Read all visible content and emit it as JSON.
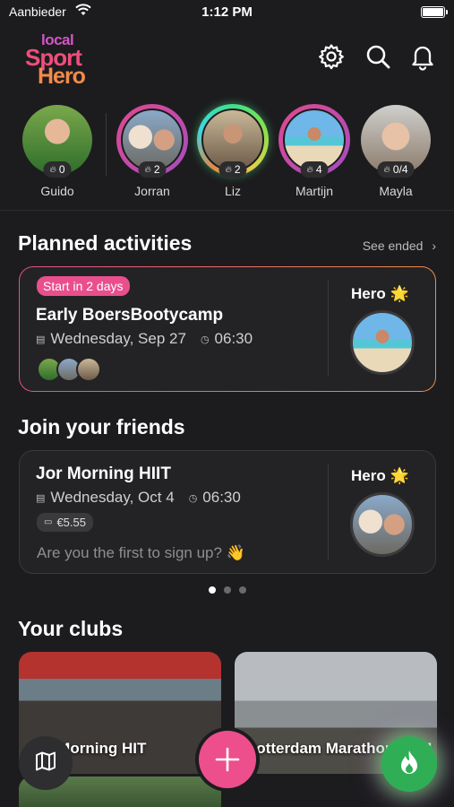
{
  "status_bar": {
    "carrier": "Aanbieder",
    "time": "1:12 PM"
  },
  "logo": {
    "line1": "local",
    "line2": "Sport",
    "line3": "Hero"
  },
  "header_icons": [
    "gear-icon",
    "search-icon",
    "bell-icon"
  ],
  "stories": [
    {
      "name": "Guido",
      "count": "0",
      "ring": "none"
    },
    {
      "name": "Jorran",
      "count": "2",
      "ring": "pink"
    },
    {
      "name": "Liz",
      "count": "2",
      "ring": "rainbow"
    },
    {
      "name": "Martijn",
      "count": "4",
      "ring": "pink"
    },
    {
      "name": "Mayla",
      "count": "0/4",
      "ring": "none"
    }
  ],
  "planned": {
    "title": "Planned activities",
    "see_ended": "See ended",
    "card": {
      "pill": "Start in 2 days",
      "name": "Early BoersBootycamp",
      "date": "Wednesday, Sep 27",
      "time": "06:30",
      "hero_label": "Hero",
      "hero_star": "🌟"
    }
  },
  "join": {
    "title": "Join your friends",
    "card": {
      "name": "Jor Morning HIIT",
      "date": "Wednesday, Oct 4",
      "time": "06:30",
      "price": "€5.55",
      "prompt": "Are you the first to sign up? 👋",
      "hero_label": "Hero",
      "hero_star": "🌟"
    },
    "pager": {
      "pages": 3,
      "active": 1
    }
  },
  "clubs": {
    "title": "Your clubs",
    "items": [
      {
        "name": "Jor Morning HIT"
      },
      {
        "name": "Rotterdam Marathon 2024"
      }
    ]
  },
  "colors": {
    "accent_pink": "#ec4f8c",
    "accent_green": "#2fae56",
    "background": "#1c1c1e"
  }
}
